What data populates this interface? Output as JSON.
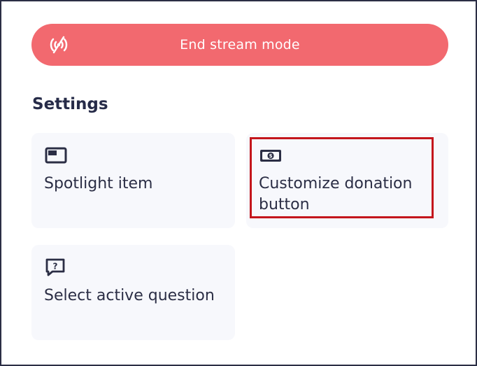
{
  "stream": {
    "end_label": "End stream mode",
    "icon": "signal-off-icon",
    "color": "#f2696f"
  },
  "settings": {
    "title": "Settings",
    "items": [
      {
        "label": "Spotlight item",
        "icon": "spotlight-icon"
      },
      {
        "label": "Customize donation button",
        "icon": "cash-icon",
        "highlighted": true
      },
      {
        "label": "Select active question",
        "icon": "question-bubble-icon"
      }
    ]
  },
  "colors": {
    "text": "#2b2e45",
    "card_background": "#f7f8fc",
    "highlight": "#c4161c"
  }
}
